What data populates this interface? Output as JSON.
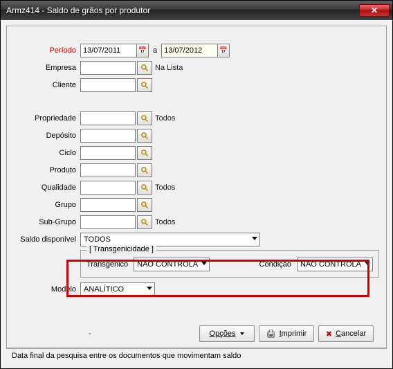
{
  "window": {
    "title": "Armz414 - Saldo de grãos por produtor"
  },
  "labels": {
    "periodo": "Período",
    "a": "a",
    "empresa": "Empresa",
    "na_lista": "Na Lista",
    "cliente": "Cliente",
    "propriedade": "Propriedade",
    "deposito": "Depósito",
    "ciclo": "Ciclo",
    "produto": "Produto",
    "qualidade": "Qualidade",
    "grupo": "Grupo",
    "subgrupo": "Sub-Grupo",
    "saldo_disponivel": "Saldo disponível",
    "transgenicidade": "[ Transgenicidade ]",
    "transgenico": "Transgênico",
    "condicao": "Condição",
    "modelo": "Modelo"
  },
  "values": {
    "periodo_de": "13/07/2011",
    "periodo_ate": "13/07/2012",
    "empresa": "",
    "cliente": "",
    "propriedade": "",
    "propriedade_desc": "Todos",
    "deposito": "",
    "ciclo": "",
    "produto": "",
    "qualidade": "",
    "qualidade_desc": "Todos",
    "grupo": "",
    "subgrupo": "",
    "subgrupo_desc": "Todos",
    "saldo_disponivel": "TODOS",
    "transgenico": "NÃO CONTROLA",
    "condicao": "NÃO CONTROLA",
    "modelo": "ANALÍTICO"
  },
  "buttons": {
    "opcoes": "Opções",
    "imprimir": "Imprimir",
    "cancelar": "Cancelar",
    "dash": "-"
  },
  "status": "Data final da pesquisa entre os documentos que movimentam saldo"
}
